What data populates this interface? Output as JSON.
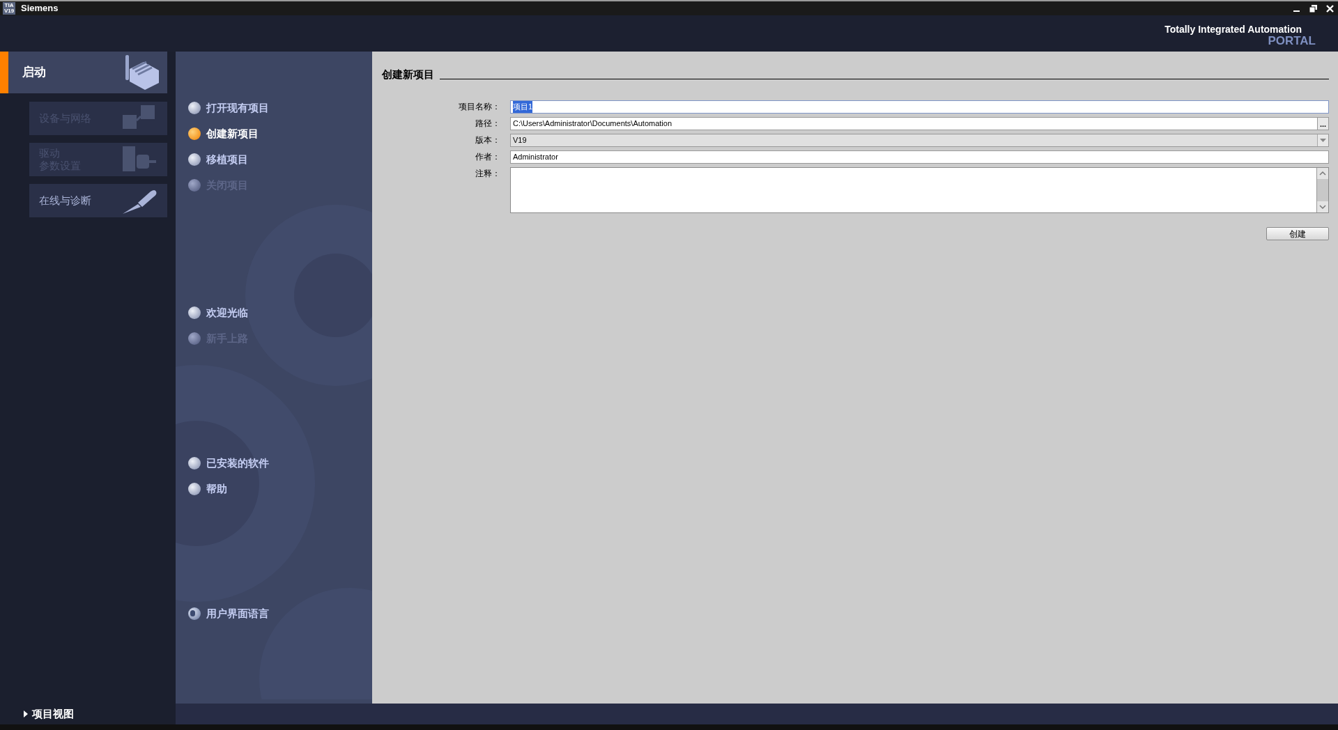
{
  "title_bar": {
    "logo_top": "TIA",
    "logo_bottom": "V19",
    "title": "Siemens"
  },
  "header": {
    "line1": "Totally Integrated Automation",
    "line2": "PORTAL"
  },
  "portals": [
    {
      "label": "启动",
      "selected": true,
      "kind": "factory"
    }
  ],
  "sub_portals": [
    {
      "lines": [
        "设备与网络"
      ],
      "disabled": true,
      "kind": "network"
    },
    {
      "lines": [
        "驱动",
        "参数设置"
      ],
      "disabled": true,
      "kind": "drive"
    },
    {
      "lines": [
        "在线与诊断"
      ],
      "disabled": false,
      "kind": "tool"
    }
  ],
  "menu_groups": [
    [
      {
        "label": "打开现有项目",
        "selected": false,
        "disabled": false,
        "kind": "ball"
      },
      {
        "label": "创建新项目",
        "selected": true,
        "disabled": false,
        "kind": "ball"
      },
      {
        "label": "移植项目",
        "selected": false,
        "disabled": false,
        "kind": "ball"
      },
      {
        "label": "关闭项目",
        "selected": false,
        "disabled": true,
        "kind": "ball"
      }
    ],
    [
      {
        "label": "欢迎光临",
        "selected": false,
        "disabled": false,
        "kind": "ball"
      },
      {
        "label": "新手上路",
        "selected": false,
        "disabled": true,
        "kind": "ball"
      }
    ],
    [
      {
        "label": "已安装的软件",
        "selected": false,
        "disabled": false,
        "kind": "ball"
      },
      {
        "label": "帮助",
        "selected": false,
        "disabled": false,
        "kind": "ball"
      }
    ],
    [
      {
        "label": "用户界面语言",
        "selected": false,
        "disabled": false,
        "kind": "globe"
      }
    ]
  ],
  "form": {
    "title": "创建新项目",
    "fields": [
      {
        "label": "项目名称：",
        "value": "项目1",
        "kind": "text",
        "highlighted": true
      },
      {
        "label": "路径：",
        "value": "C:\\Users\\Administrator\\Documents\\Automation",
        "kind": "browse",
        "button": "..."
      },
      {
        "label": "版本：",
        "value": "V19",
        "kind": "dropdown"
      },
      {
        "label": "作者：",
        "value": "Administrator",
        "kind": "text",
        "highlighted": false
      },
      {
        "label": "注释：",
        "kind": "textarea"
      }
    ],
    "submit": "创建"
  },
  "footer": {
    "label": "项目视图"
  }
}
